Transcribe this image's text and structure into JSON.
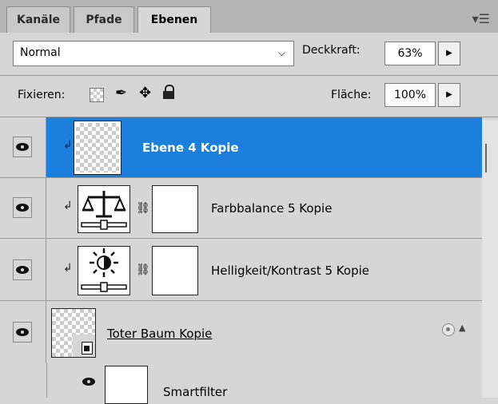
{
  "tabs": [
    {
      "label": "Kanäle"
    },
    {
      "label": "Pfade"
    },
    {
      "label": "Ebenen"
    }
  ],
  "blend": {
    "mode": "Normal",
    "opacity_label": "Deckkraft:",
    "opacity": "63%"
  },
  "lock": {
    "label": "Fixieren:",
    "fill_label": "Fläche:",
    "fill": "100%"
  },
  "layers": [
    {
      "name": "Ebene 4 Kopie"
    },
    {
      "name": "Farbbalance 5 Kopie"
    },
    {
      "name": "Helligkeit/Kontrast 5 Kopie"
    },
    {
      "name": "Toter Baum Kopie"
    },
    {
      "name": "Smartfilter"
    }
  ],
  "colors": {
    "selected": "#1c7fdc",
    "panel": "#d6d6d6"
  }
}
